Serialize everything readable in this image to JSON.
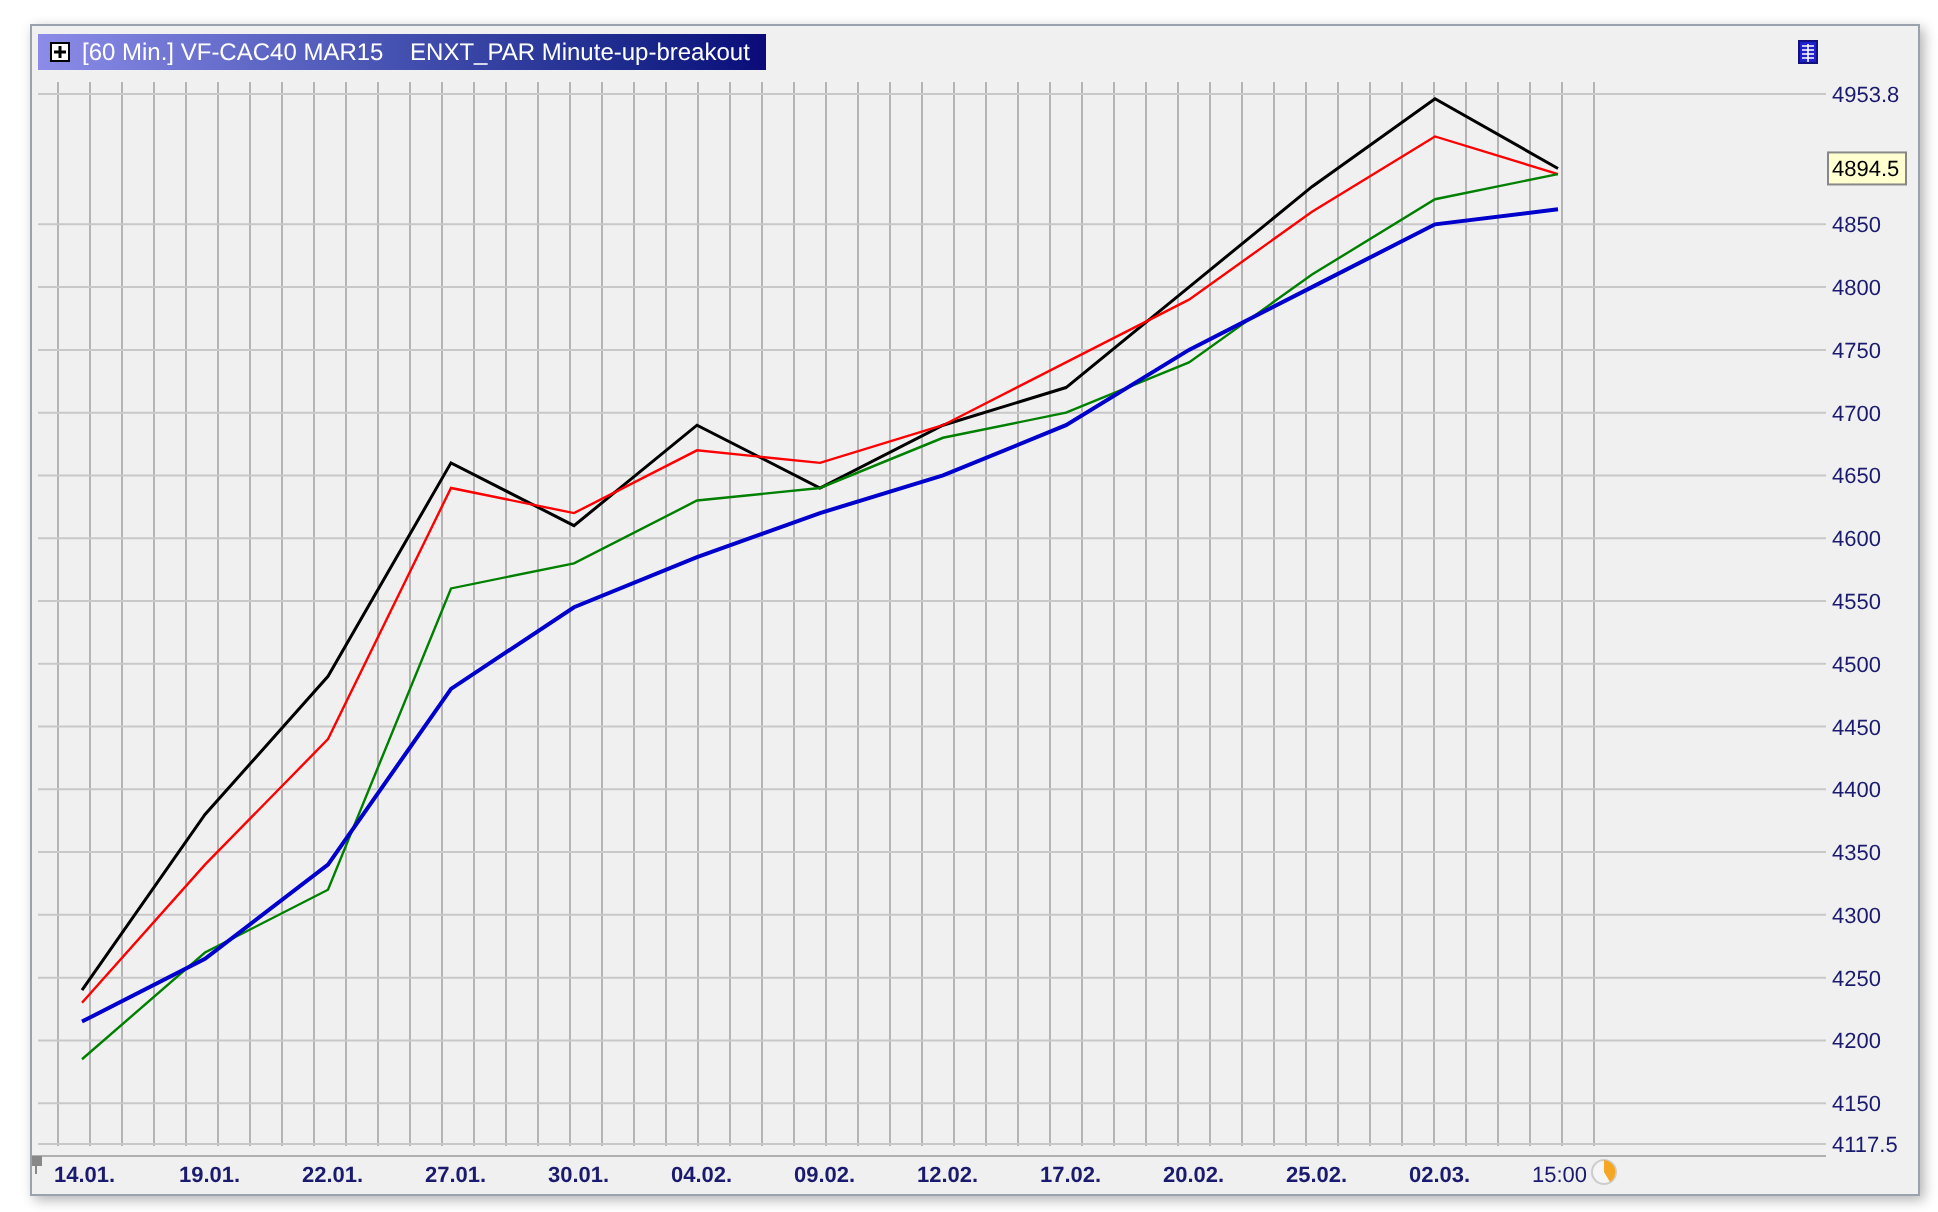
{
  "window": {
    "title": "[60 Min.] VF-CAC40 MAR15    ENXT_PAR Minute-up-breakout"
  },
  "chart": {
    "current_price": "4894.5",
    "chart_data": {
      "type": "line",
      "categories": [
        "14.01.",
        "19.01.",
        "22.01.",
        "27.01.",
        "30.01.",
        "04.02.",
        "09.02.",
        "12.02.",
        "17.02.",
        "20.02.",
        "25.02.",
        "02.03.",
        "15:00"
      ],
      "grid": true,
      "ylim": [
        4117.5,
        4953.8
      ],
      "yticks": [
        {
          "value": 4117.5,
          "label": "4117.5"
        },
        4150,
        4200,
        4250,
        4300,
        4350,
        4400,
        4450,
        4500,
        4550,
        4600,
        4650,
        4700,
        4750,
        4800,
        4850,
        {
          "value": 4953.8,
          "label": "4953.8"
        }
      ],
      "series": [
        {
          "color": "#000000",
          "values": [
            4240,
            4380,
            4490,
            4660,
            4610,
            4690,
            4640,
            4690,
            4720,
            4800,
            4880,
            4950,
            4894.5
          ]
        },
        {
          "color": "#ff0000",
          "values": [
            4230,
            4340,
            4440,
            4640,
            4620,
            4670,
            4660,
            4690,
            4740,
            4790,
            4860,
            4920,
            4890
          ]
        },
        {
          "color": "#008000",
          "values": [
            4185,
            4270,
            4320,
            4560,
            4580,
            4630,
            4640,
            4680,
            4700,
            4740,
            4810,
            4870,
            4890
          ]
        },
        {
          "color": "#0000cc",
          "values": [
            4215,
            4265,
            4340,
            4480,
            4545,
            4585,
            4620,
            4650,
            4690,
            4750,
            4800,
            4850,
            4862
          ]
        }
      ]
    }
  }
}
